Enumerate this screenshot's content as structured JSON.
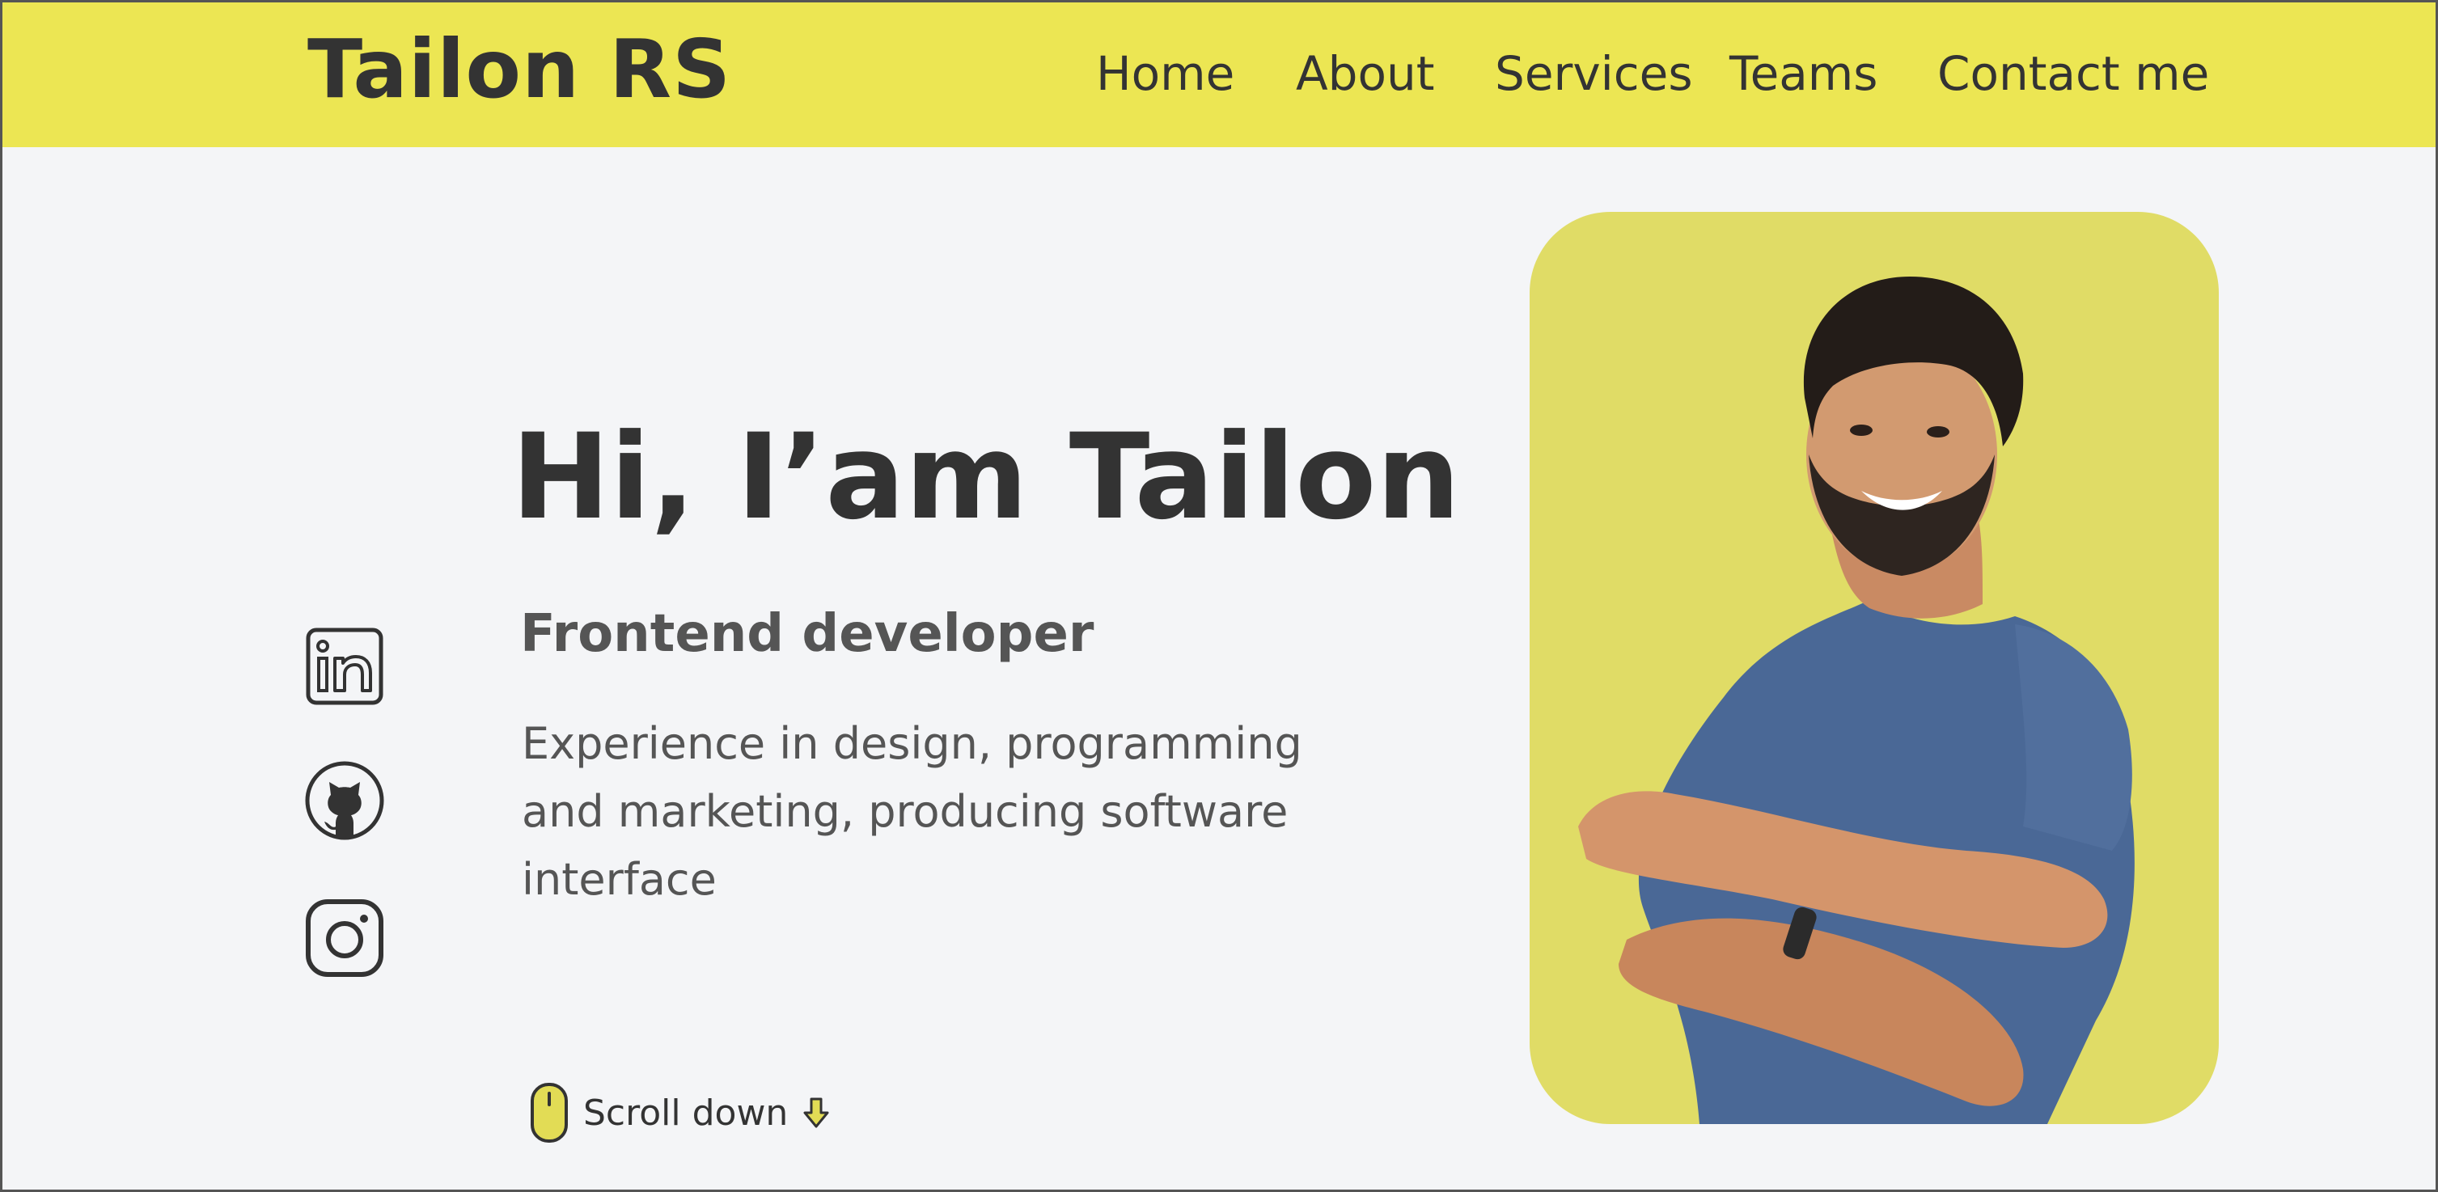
{
  "header": {
    "brand": "Tailon RS",
    "nav": [
      "Home",
      "About",
      "Services",
      "Teams",
      "Contact me"
    ]
  },
  "hero": {
    "title": "Hi, I’am Tailon",
    "subtitle": "Frontend developer",
    "description": "Experience in design, programming and marketing, producing software interface"
  },
  "social": [
    {
      "icon": "linkedin-icon"
    },
    {
      "icon": "github-icon"
    },
    {
      "icon": "instagram-icon"
    }
  ],
  "scroll": {
    "label": "Scroll down",
    "icon": "mouse-icon",
    "arrow_icon": "arrow-down-icon"
  },
  "colors": {
    "header_bg": "#ece653",
    "page_bg": "#f4f5f7",
    "card_bg": "#e0dc66",
    "text_dark": "#333333",
    "text_muted": "#555555",
    "accent": "#e2dc55"
  }
}
